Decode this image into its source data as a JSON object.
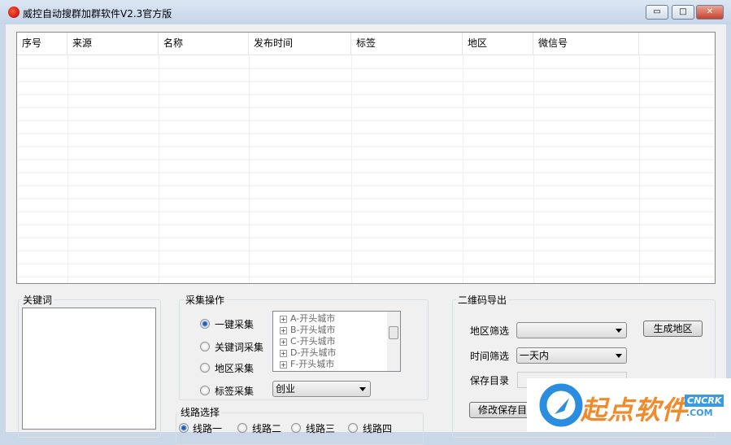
{
  "window": {
    "title": "威控自动搜群加群软件V2.3官方版",
    "min": "▭",
    "max": "□",
    "close": "✕"
  },
  "table": {
    "columns": [
      "序号",
      "来源",
      "名称",
      "发布时间",
      "标签",
      "地区",
      "微信号",
      ""
    ]
  },
  "keyword": {
    "label": "关键词",
    "value": ""
  },
  "collect": {
    "label": "采集操作",
    "options": [
      {
        "label": "一键采集",
        "checked": true
      },
      {
        "label": "关键词采集",
        "checked": false
      },
      {
        "label": "地区采集",
        "checked": false
      },
      {
        "label": "标签采集",
        "checked": false
      }
    ],
    "tree": [
      "A-开头城市",
      "B-开头城市",
      "C-开头城市",
      "D-开头城市",
      "F-开头城市"
    ],
    "tag_select": "创业"
  },
  "route": {
    "label": "线路选择",
    "options": [
      {
        "label": "线路一",
        "checked": true
      },
      {
        "label": "线路二",
        "checked": false
      },
      {
        "label": "线路三",
        "checked": false
      },
      {
        "label": "线路四",
        "checked": false
      }
    ]
  },
  "qrexport": {
    "label": "二维码导出",
    "region_label": "地区筛选",
    "region_value": "",
    "generate_button": "生成地区",
    "time_label": "时间筛选",
    "time_value": "一天内",
    "savedir_label": "保存目录",
    "savedir_value": "",
    "change_dir_button": "修改保存目"
  },
  "watermark": {
    "text": "起点软件",
    "sub1": "CNCRK",
    "sub2": ".COM"
  }
}
